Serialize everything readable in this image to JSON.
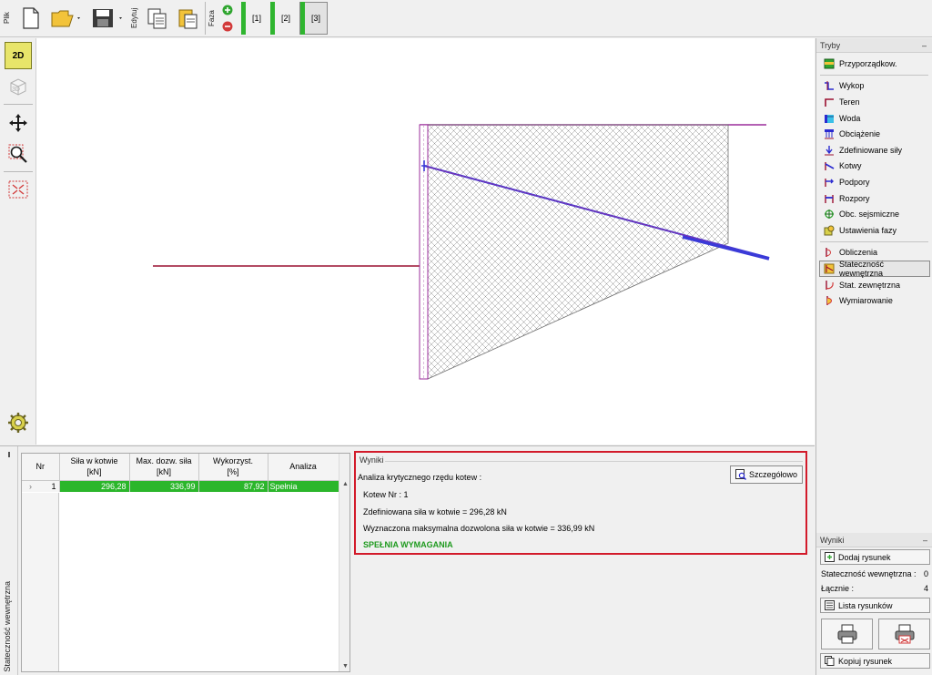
{
  "toolbar": {
    "file_label": "Plik",
    "edit_label": "Edytuj",
    "phase_label": "Faza",
    "phases": [
      "[1]",
      "[2]",
      "[3]"
    ],
    "active_phase": "[3]"
  },
  "left_tools": {
    "view_2d": "2D",
    "view_3d": "3D"
  },
  "right_panel": {
    "modes_title": "Tryby",
    "modes_group1": [
      "Przyporządkow."
    ],
    "modes_group2": [
      "Wykop",
      "Teren",
      "Woda",
      "Obciążenie",
      "Zdefiniowane siły",
      "Kotwy",
      "Podpory",
      "Rozpory",
      "Obc. sejsmiczne",
      "Ustawienia fazy"
    ],
    "modes_group3": [
      "Obliczenia",
      "Stateczność wewnętrzna",
      "Stat. zewnętrzna",
      "Wymiarowanie"
    ],
    "selected_mode": "Stateczność wewnętrzna",
    "results_title": "Wyniki",
    "add_drawing": "Dodaj rysunek",
    "internal_stability_label": "Stateczność wewnętrzna :",
    "internal_stability_count": "0",
    "total_label": "Łącznie :",
    "total_count": "4",
    "drawing_list": "Lista rysunków",
    "copy_drawing": "Kopiuj rysunek"
  },
  "bottom": {
    "vertical_label": "Stateczność wewnętrzna",
    "table": {
      "headers": [
        {
          "l1": "Nr",
          "l2": ""
        },
        {
          "l1": "Siła w kotwie",
          "l2": "[kN]"
        },
        {
          "l1": "Max. dozw. siła",
          "l2": "[kN]"
        },
        {
          "l1": "Wykorzyst.",
          "l2": "[%]"
        },
        {
          "l1": "Analiza",
          "l2": ""
        }
      ],
      "rows": [
        {
          "nr": "1",
          "force": "296,28",
          "max_force": "336,99",
          "utilization": "87,92",
          "analysis": "Spełnia"
        }
      ]
    },
    "results": {
      "title": "Wyniki",
      "heading": "Analiza krytycznego rzędu kotew :",
      "anchor_nr": "Kotew Nr : 1",
      "defined_force": "Zdefiniowana siła w kotwie = 296,28 kN",
      "max_force": "Wyznaczona maksymalna dozwolona siła w kotwie = 336,99 kN",
      "verdict": "SPEŁNIA WYMAGANIA",
      "detail_button": "Szczegółowo"
    }
  },
  "colors": {
    "accent_green": "#2bb62b",
    "results_border": "#d21a2a",
    "selected_yellow": "#e8e56a",
    "terrain_purple": "#9b2d9b",
    "anchor_blue": "#3a3ad8",
    "excavation_red": "#9a1030"
  }
}
